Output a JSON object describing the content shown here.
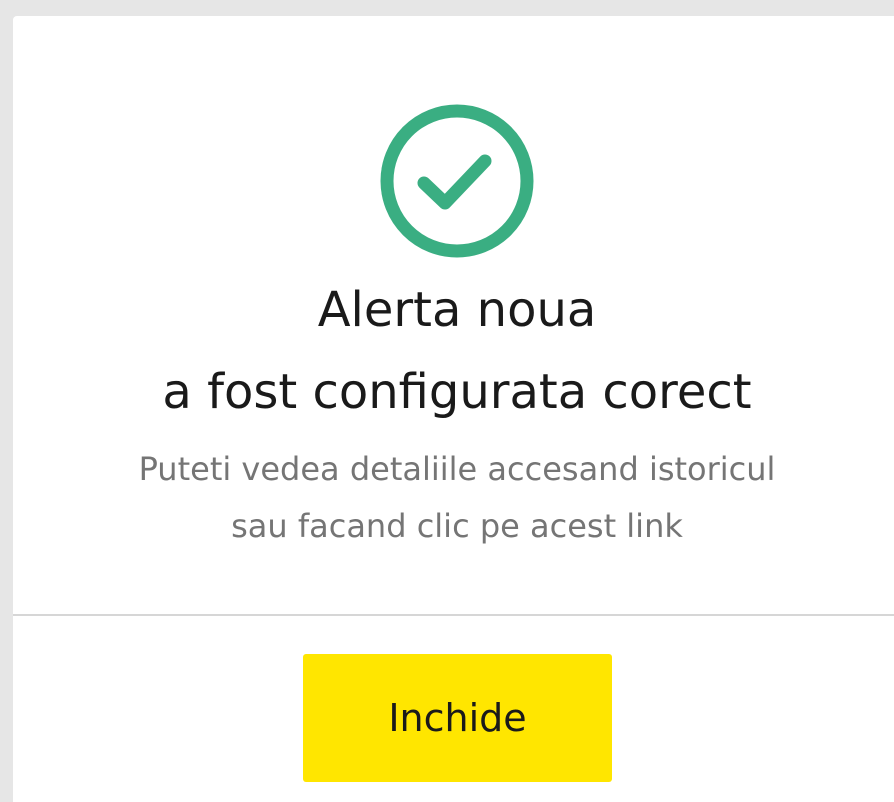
{
  "modal": {
    "title_line1": "Alerta noua",
    "title_line2": "a fost configurata corect",
    "message_line1": "Puteti vedea detaliile accesand istoricul",
    "message_line2": "sau facand clic pe acest link",
    "close_label": "Inchide",
    "icon": "check-circle-icon"
  },
  "colors": {
    "success": "#3aae82",
    "accent": "#ffe600",
    "title_text": "#1a1a1a",
    "body_text": "#757575",
    "divider": "#d6d6d6"
  }
}
